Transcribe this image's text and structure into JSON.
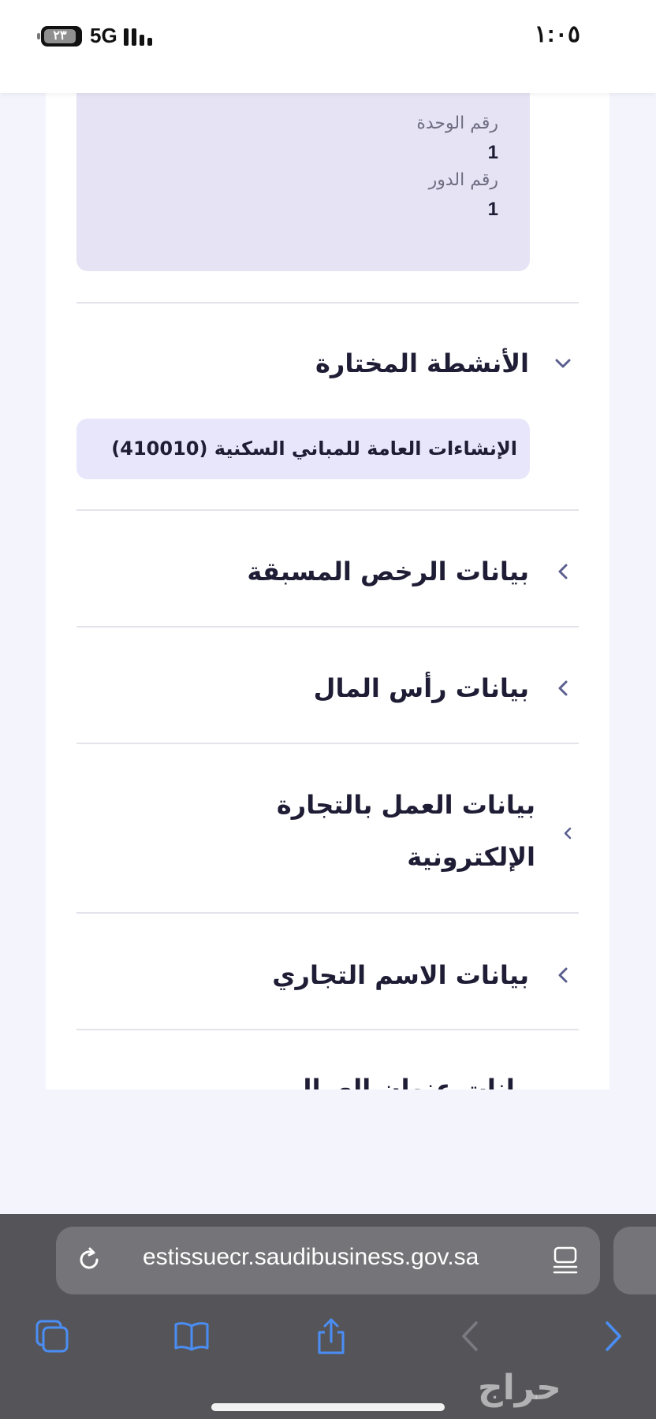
{
  "status_bar": {
    "time": "١:٠٥",
    "battery": "٢٣",
    "network": "5G"
  },
  "address_details": {
    "unit_number_label": "رقم الوحدة",
    "unit_number_value": "1",
    "floor_number_label": "رقم الدور",
    "floor_number_value": "1"
  },
  "sections": {
    "selected_activities": {
      "title": "الأنشطة المختارة",
      "expanded": true,
      "items": [
        "الإنشاءات العامة للمباني السكنية (410010)"
      ]
    },
    "previous_licenses": {
      "title": "بيانات الرخص المسبقة"
    },
    "capital": {
      "title": "بيانات رأس المال"
    },
    "ecommerce": {
      "title": "بيانات العمل بالتجارة الإلكترونية"
    },
    "trade_name": {
      "title": "بيانات الاسم التجاري"
    },
    "cut_off": {
      "title": "بيانات عنوان العمال"
    }
  },
  "browser": {
    "url": "estissuecr.saudibusiness.gov.sa"
  },
  "watermark": "حراج",
  "colors": {
    "accent": "#4f5bb8",
    "chevron": "#5b5f8e",
    "toolbar_icon": "#4a8ef5",
    "info_box_bg": "#e6e4f4",
    "chip_bg": "#e8e6fb"
  }
}
